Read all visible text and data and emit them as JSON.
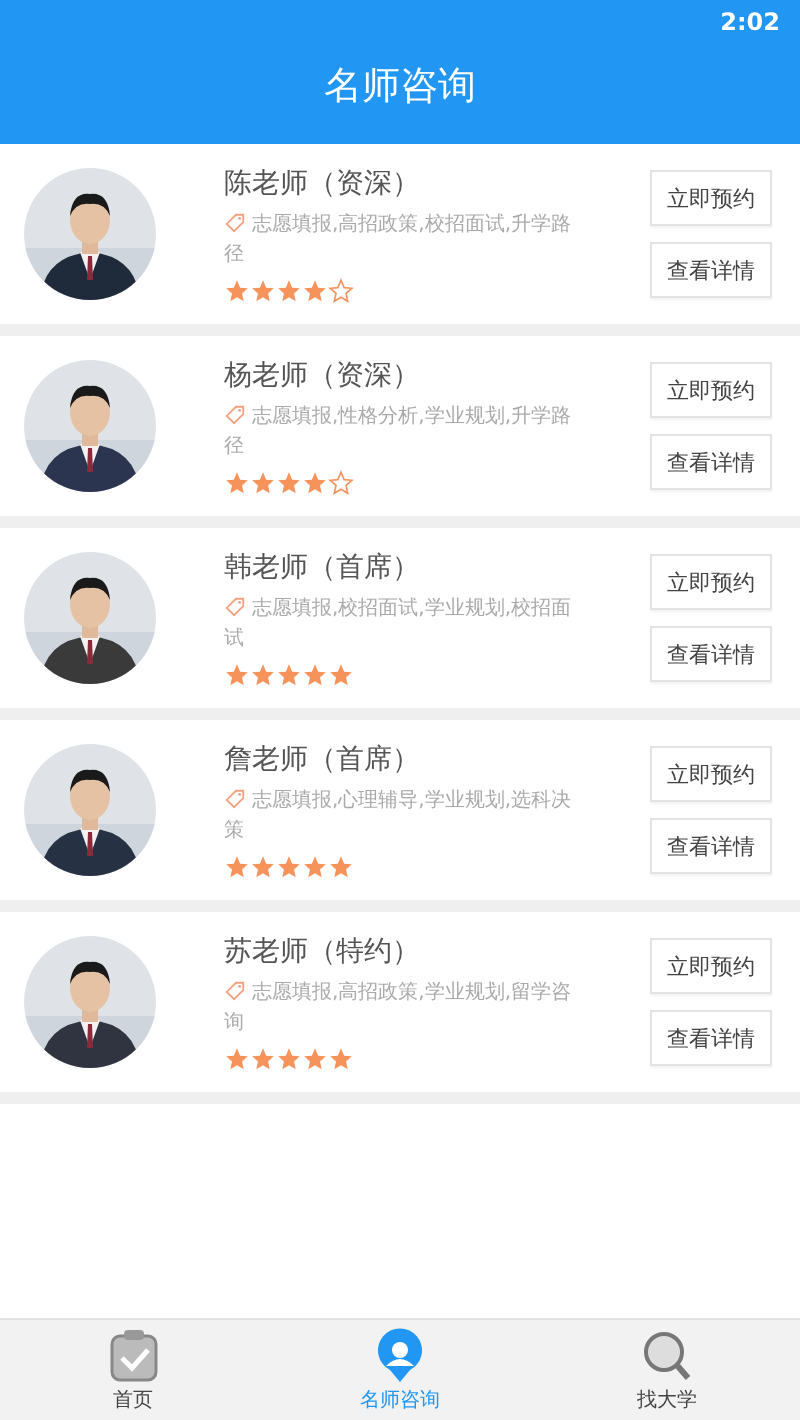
{
  "status_bar": {
    "time": "2:02"
  },
  "header": {
    "title": "名师咨询"
  },
  "teachers": [
    {
      "name": "陈老师（资深）",
      "tags": "志愿填报,高招政策,校招面试,升学路径",
      "stars": 4,
      "buttons": [
        "立即预约",
        "查看详情"
      ]
    },
    {
      "name": "杨老师（资深）",
      "tags": "志愿填报,性格分析,学业规划,升学路径",
      "stars": 4,
      "buttons": [
        "立即预约",
        "查看详情"
      ]
    },
    {
      "name": "韩老师（首席）",
      "tags": "志愿填报,校招面试,学业规划,校招面试",
      "stars": 5,
      "buttons": [
        "立即预约",
        "查看详情"
      ]
    },
    {
      "name": "詹老师（首席）",
      "tags": "志愿填报,心理辅导,学业规划,选科决策",
      "stars": 5,
      "buttons": [
        "立即预约",
        "查看详情"
      ]
    },
    {
      "name": "苏老师（特约）",
      "tags": "志愿填报,高招政策,学业规划,留学咨询",
      "stars": 5,
      "buttons": [
        "立即预约",
        "查看详情"
      ]
    }
  ],
  "tab_bar": [
    {
      "kind": "home",
      "label": "首页",
      "selected": false
    },
    {
      "kind": "consult",
      "label": "名师咨询",
      "selected": true
    },
    {
      "kind": "search",
      "label": "找大学",
      "selected": false
    }
  ]
}
